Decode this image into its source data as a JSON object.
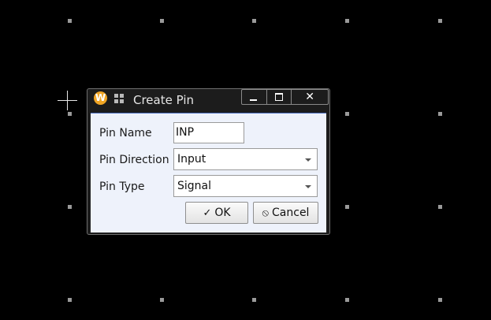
{
  "dialog": {
    "app_icon_letter": "W",
    "title": "Create Pin",
    "window_controls": {
      "minimize": "minimize",
      "maximize": "maximize",
      "close": "✕"
    },
    "fields": {
      "pin_name": {
        "label": "Pin Name",
        "value": "INP"
      },
      "pin_direction": {
        "label": "Pin Direction",
        "value": "Input"
      },
      "pin_type": {
        "label": "Pin Type",
        "value": "Signal"
      }
    },
    "buttons": {
      "ok": {
        "icon": "✓",
        "label": "OK"
      },
      "cancel": {
        "icon": "⦸",
        "label": "Cancel"
      }
    }
  },
  "colors": {
    "canvas_background": "#000000",
    "grid_dot": "#9a9a9a",
    "dialog_body": "#eef2fb",
    "accent_line": "#4d6fbf",
    "app_icon": "#f0a524"
  }
}
